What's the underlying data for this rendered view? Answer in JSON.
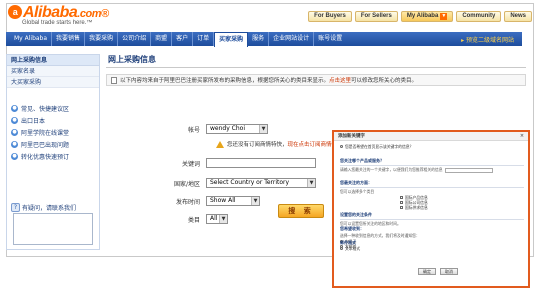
{
  "header": {
    "logo_text": "Alibaba",
    "logo_suffix": ".com",
    "logo_reg": "®",
    "tagline": "Global trade starts here.™",
    "toplinks": {
      "for_buyers": "For Buyers",
      "for_sellers": "For Sellers",
      "my_alibaba": "My Alibaba",
      "community": "Community",
      "news": "News"
    }
  },
  "nav": {
    "items": [
      "My Alibaba",
      "我要销售",
      "我要采购",
      "公司介绍",
      "商盟",
      "客户",
      "订单",
      "买家采购",
      "服务",
      "企业网站设计",
      "账号设置"
    ],
    "active_index": 7,
    "right_link": "预览二级域名网站"
  },
  "sidebar": {
    "header": "网上采购信息",
    "rows": [
      "买家名录",
      "大买家采购"
    ],
    "links": [
      "常见、快捷建议区",
      "出口日本",
      "阿里学院在线课堂",
      "阿里巴巴出现问题",
      "转化优惠快速预订"
    ],
    "ask_label": "有疑问，请联系我们"
  },
  "main": {
    "title": "网上采购信息",
    "info_text": "以下内容均来自于阿里巴巴注册买家所发布的采购信息，根据您所关心的类目来显示。",
    "info_link": "点击这里",
    "info_tail": "可以修改您所关心的类目。",
    "account_label": "帐号",
    "account_value": "wendy Choi",
    "warn_text": "您还没有订阅商情特快，",
    "warn_link": "现在点击订阅商情特快",
    "keyword_label": "关键词",
    "region_label": "国家/地区",
    "region_value": "Select Country or Territory",
    "time_label": "发布时间",
    "time_value": "Show All",
    "category_label": "类目",
    "category_value": "All",
    "search_button": "搜 索"
  },
  "popup": {
    "title": "添加新关键字",
    "close": "×",
    "intro": "您是否希望在首页显示该关键字的信息？",
    "s1_head": "您关注哪个产品或服务？",
    "s1_text": "请输入您最关注的一个关键字，以便我们为您推荐相关的信息",
    "s2_head": "您最关注的方面：",
    "s2_text": "您可以选择多个类目",
    "s2_options": [
      "国际产品信息",
      "国际公司信息",
      "国际供求信息"
    ],
    "s3_head": "设置您的关注条件",
    "s3_text": "您可以设置您所关注的地区和时间。",
    "s4_head": "您希望收到：",
    "s4_text": "选择一种收到信息的方式，我们将及时通知您：",
    "s4_options": [
      "仅显示",
      "发邮件"
    ],
    "s5_head": "邮件格式",
    "s5_options": [
      "文本格式",
      "网页格式"
    ],
    "ok_button": "确定",
    "cancel_button": "取消"
  }
}
